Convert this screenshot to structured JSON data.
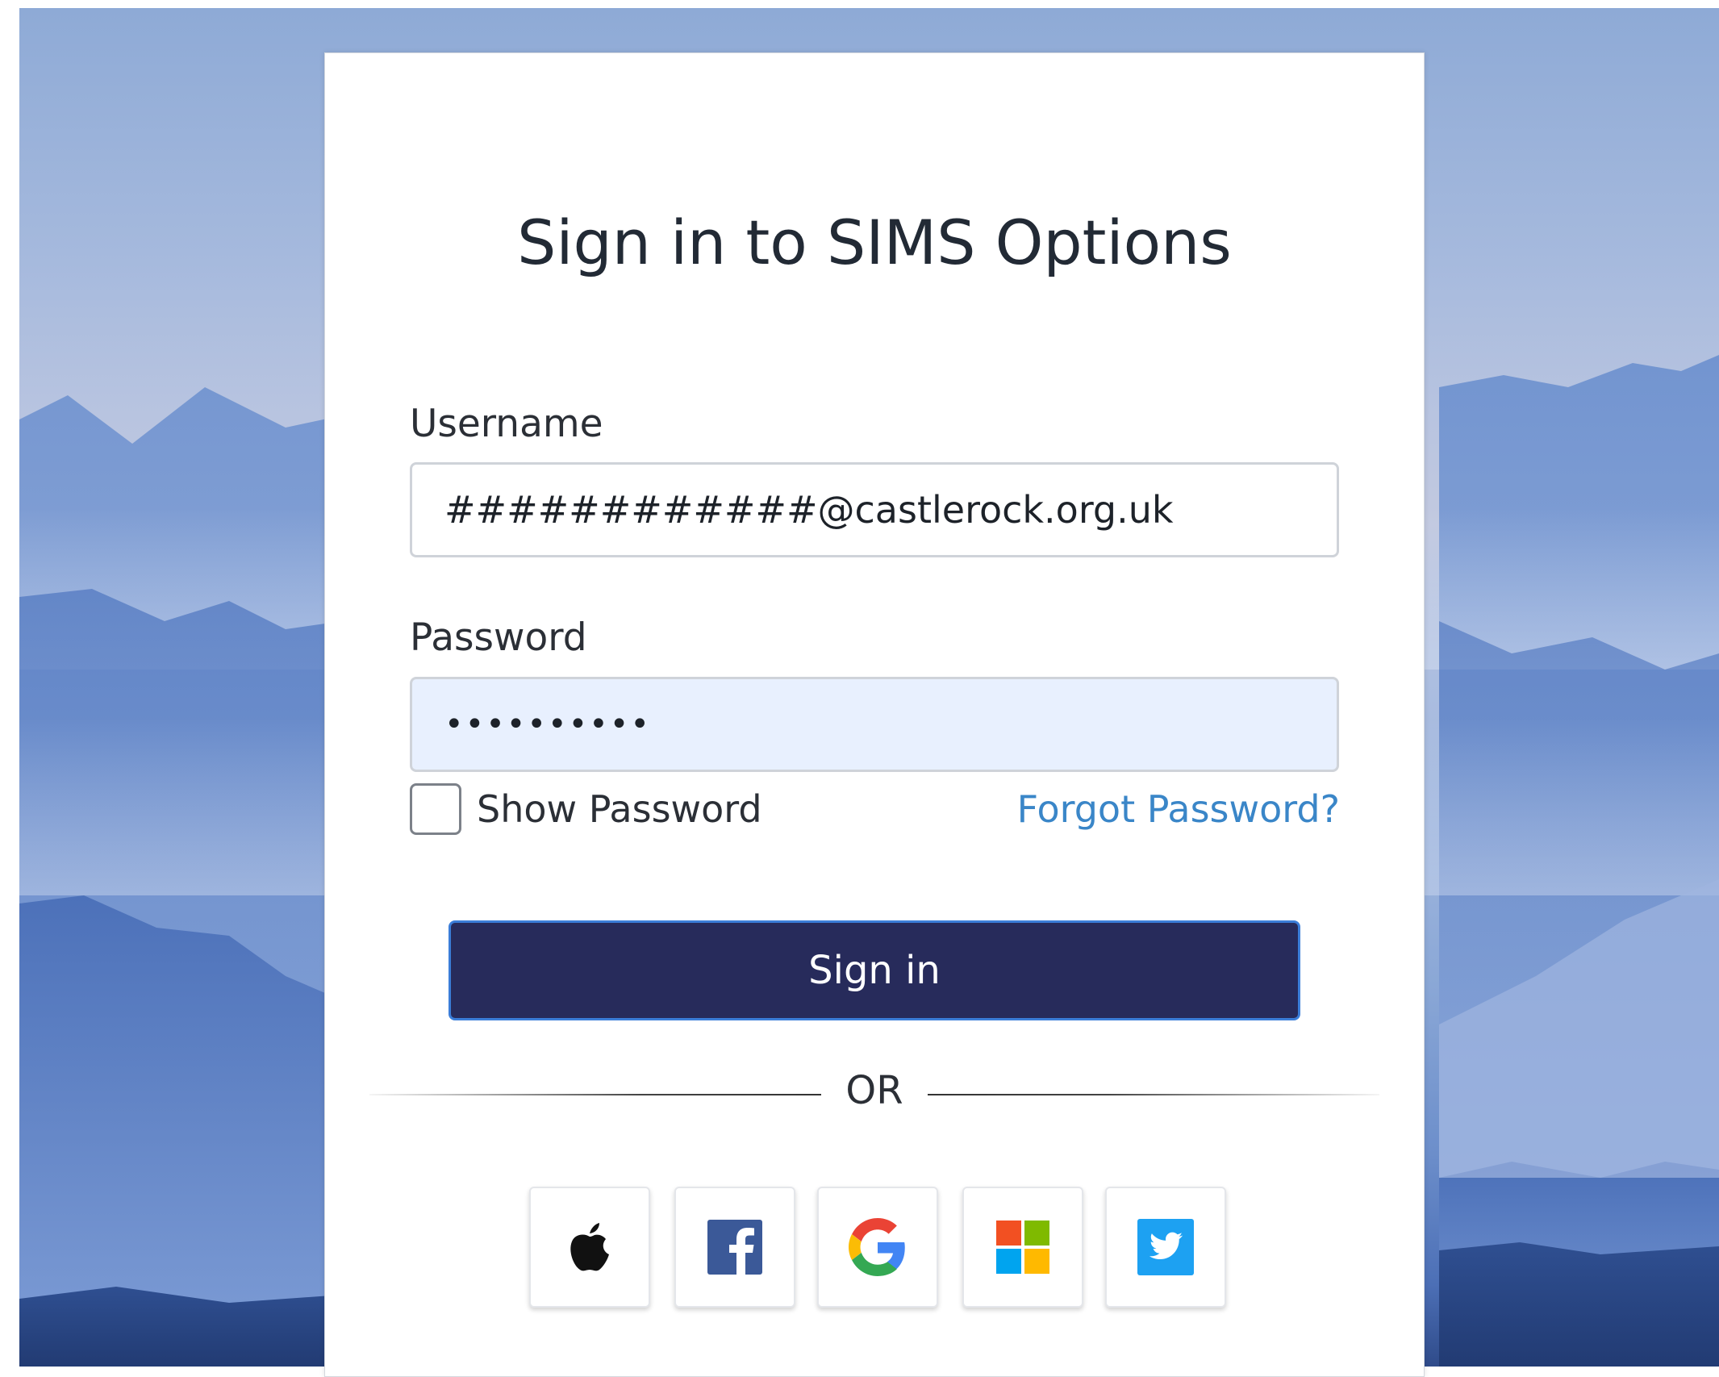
{
  "login": {
    "title": "Sign in to SIMS Options",
    "username": {
      "label": "Username",
      "value": "############@castlerock.org.uk"
    },
    "password": {
      "label": "Password",
      "value": "••••••••••"
    },
    "show_password": {
      "label": "Show Password",
      "checked": false
    },
    "forgot_password": "Forgot Password?",
    "sign_in_button": "Sign in",
    "divider_text": "OR",
    "providers": [
      {
        "name": "Apple",
        "icon": "apple-icon"
      },
      {
        "name": "Facebook",
        "icon": "facebook-icon"
      },
      {
        "name": "Google",
        "icon": "google-icon"
      },
      {
        "name": "Microsoft",
        "icon": "microsoft-icon"
      },
      {
        "name": "Twitter",
        "icon": "twitter-icon"
      }
    ]
  },
  "colors": {
    "primary_button": "#272b5b",
    "button_focus_border": "#3b7dd8",
    "link": "#3a86c8",
    "password_autofill_bg": "#e8f0fe"
  }
}
